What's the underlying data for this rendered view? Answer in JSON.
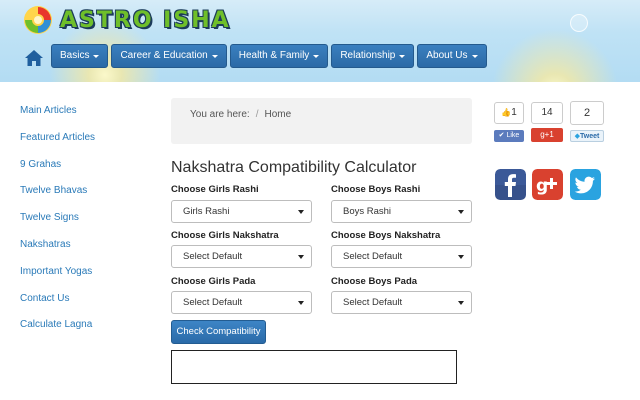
{
  "brand": {
    "name": "ASTRO ISHA"
  },
  "nav": {
    "items": [
      {
        "label": "Basics"
      },
      {
        "label": "Career & Education"
      },
      {
        "label": "Health & Family"
      },
      {
        "label": "Relationship"
      },
      {
        "label": "About Us"
      }
    ]
  },
  "sidebar": {
    "links": [
      "Main Articles",
      "Featured Articles",
      "9 Grahas",
      "Twelve Bhavas",
      "Twelve Signs",
      "Nakshatras",
      "Important Yogas",
      "Contact Us",
      "Calculate Lagna"
    ]
  },
  "breadcrumb": {
    "prefix": "You are here:",
    "separator": "/",
    "current": "Home"
  },
  "calculator": {
    "title": "Nakshatra Compatibility Calculator",
    "girls_rashi": {
      "label": "Choose Girls Rashi",
      "value": "Girls Rashi"
    },
    "boys_rashi": {
      "label": "Choose Boys Rashi",
      "value": "Boys Rashi"
    },
    "girls_nakshatra": {
      "label": "Choose Girls Nakshatra",
      "value": "Select Default"
    },
    "boys_nakshatra": {
      "label": "Choose Boys Nakshatra",
      "value": "Select Default"
    },
    "girls_pada": {
      "label": "Choose Girls Pada",
      "value": "Select Default"
    },
    "boys_pada": {
      "label": "Choose Boys Pada",
      "value": "Select Default"
    },
    "button": "Check Compatibility",
    "result": ""
  },
  "social": {
    "facebook": {
      "count": "1",
      "label": "Like"
    },
    "gplus": {
      "count": "14",
      "label": "g+1"
    },
    "twitter": {
      "count": "2",
      "label": "Tweet"
    },
    "icons": [
      "facebook-icon",
      "google-plus-icon",
      "twitter-icon"
    ]
  },
  "colors": {
    "nav_bg": "#2b6aa6",
    "link": "#2a7ab8",
    "logo_green": "#6fbf2a",
    "facebook": "#3b5998",
    "gplus": "#d9412f",
    "twitter": "#2aa3e0"
  }
}
